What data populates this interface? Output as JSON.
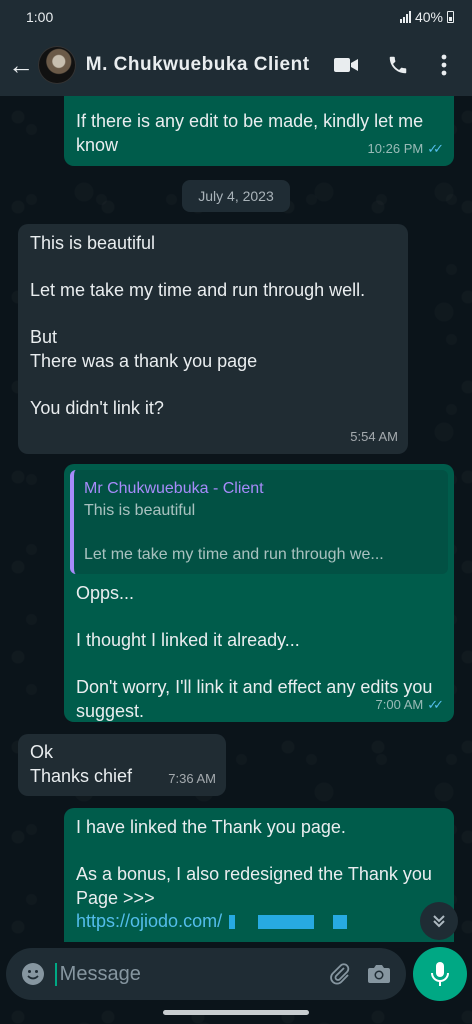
{
  "status_bar": {
    "time": "1:00",
    "battery": "40%"
  },
  "header": {
    "contact_name": "M. Chukwuebuka Client"
  },
  "messages": [
    {
      "id": "m1",
      "direction": "out",
      "text": "If there is any edit to be made, kindly let me know",
      "time": "10:26 PM",
      "read": true
    },
    {
      "id": "date",
      "date_label": "July 4, 2023"
    },
    {
      "id": "m2",
      "direction": "in",
      "text": "This is beautiful\n\nLet me take my time and run through well.\n\nBut\nThere was a thank you page\n\nYou didn't link it?",
      "time": "5:54 AM"
    },
    {
      "id": "m3",
      "direction": "out",
      "quote": {
        "author": "Mr Chukwuebuka - Client",
        "text": "This is beautiful\n\nLet me take my time and run through we..."
      },
      "text": "Opps...\n\nI thought I linked it already...\n\nDon't worry, I'll link it and effect any edits you suggest.",
      "time": "7:00 AM",
      "read": true
    },
    {
      "id": "m4",
      "direction": "in",
      "text": "Ok\nThanks chief",
      "time": "7:36 AM"
    },
    {
      "id": "m5",
      "direction": "out",
      "text": "I have linked the Thank you page.\n\nAs a bonus, I also redesigned the Thank you Page >>>",
      "link": "https://ojiodo.com/"
    }
  ],
  "composer": {
    "placeholder": "Message"
  },
  "colors": {
    "outgoing": "#005c4b",
    "incoming": "#202c33",
    "accent": "#00a884",
    "read_ticks": "#53bdeb"
  }
}
